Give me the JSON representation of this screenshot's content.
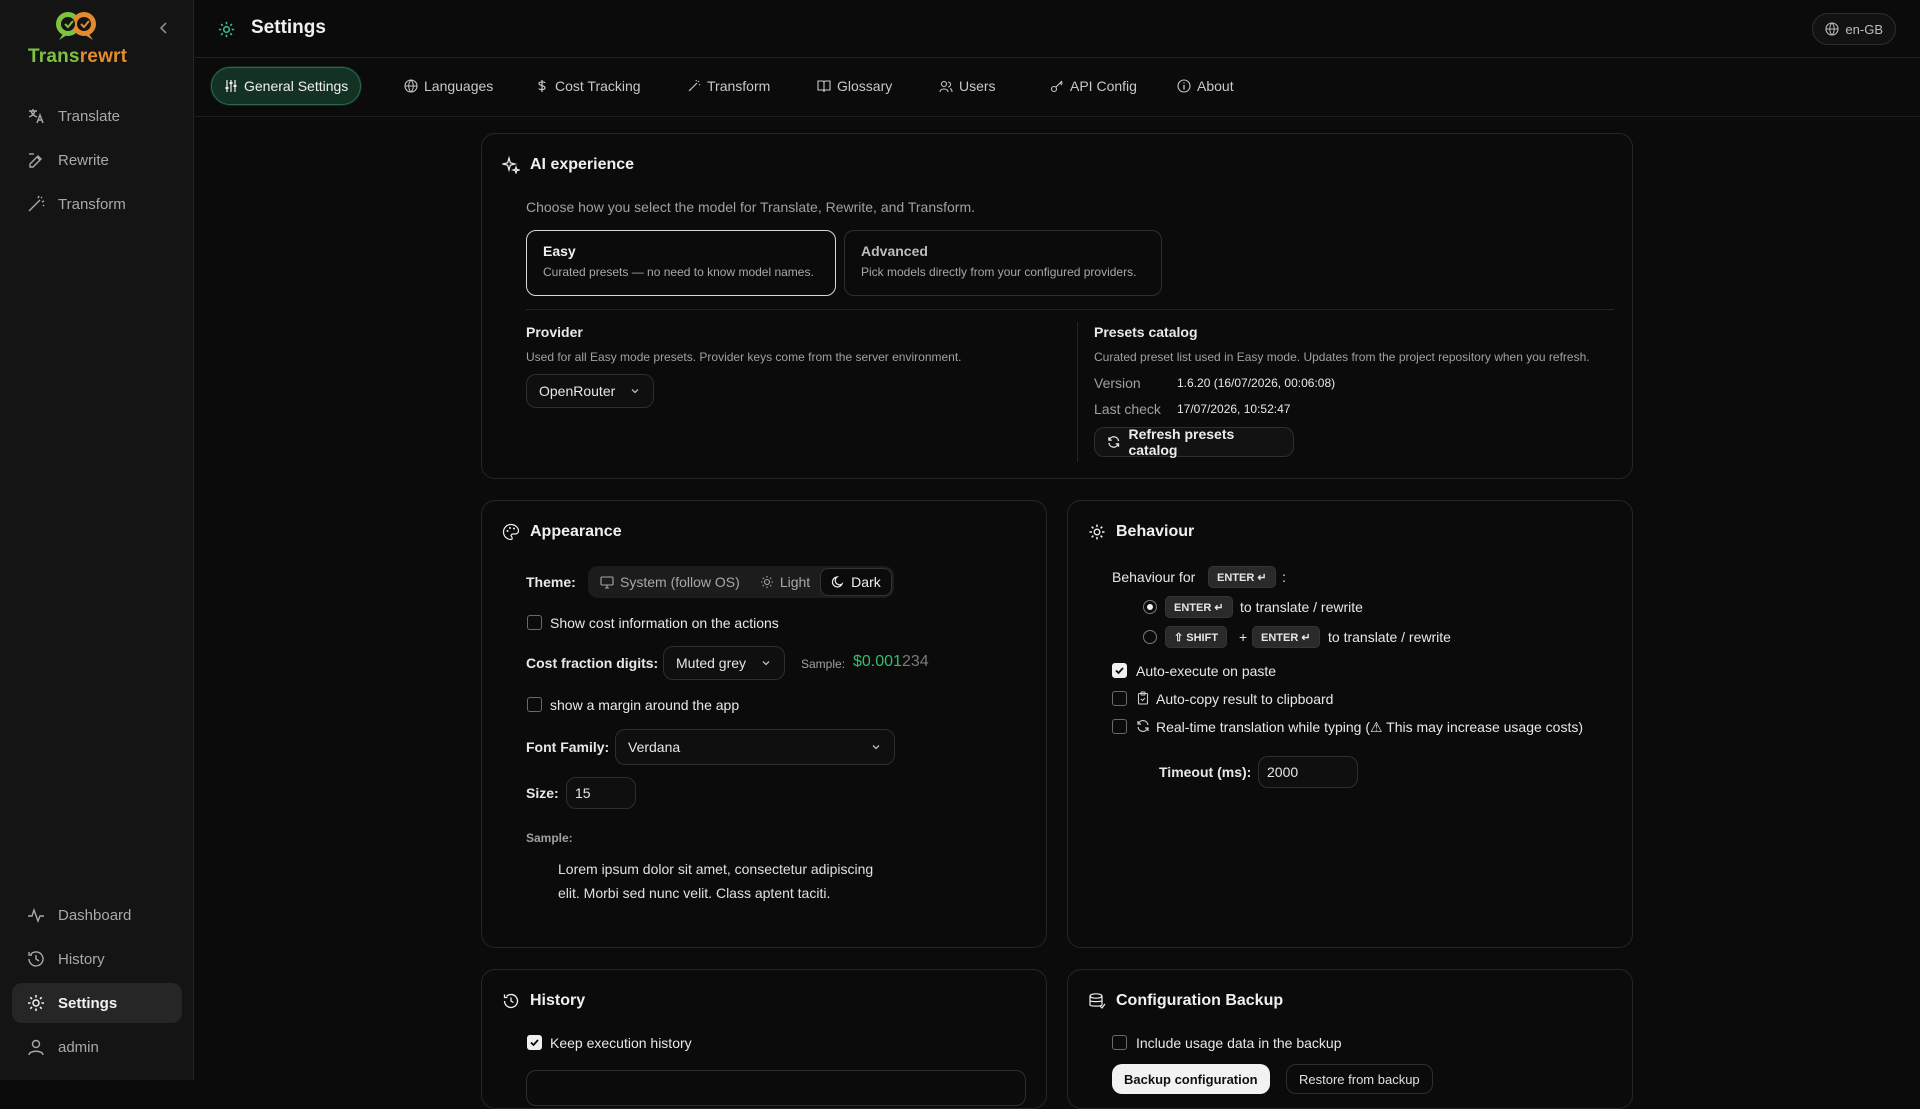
{
  "app": {
    "name_part1": "Trans",
    "name_part2": "rewrt"
  },
  "sidebar": {
    "top": [
      {
        "label": "Translate",
        "icon": "translate-icon"
      },
      {
        "label": "Rewrite",
        "icon": "rewrite-icon"
      },
      {
        "label": "Transform",
        "icon": "wand-icon"
      }
    ],
    "bottom": [
      {
        "label": "Dashboard",
        "icon": "activity-icon"
      },
      {
        "label": "History",
        "icon": "history-icon"
      },
      {
        "label": "Settings",
        "icon": "gear-icon",
        "active": true
      },
      {
        "label": "admin",
        "icon": "user-icon"
      }
    ]
  },
  "header": {
    "title": "Settings",
    "locale": "en-GB"
  },
  "tabs": [
    {
      "label": "General Settings",
      "active": true
    },
    {
      "label": "Languages"
    },
    {
      "label": "Cost Tracking"
    },
    {
      "label": "Transform"
    },
    {
      "label": "Glossary"
    },
    {
      "label": "Users"
    },
    {
      "label": "API Config"
    },
    {
      "label": "About"
    }
  ],
  "ai": {
    "title": "AI experience",
    "desc": "Choose how you select the model for Translate, Rewrite, and Transform.",
    "easy": {
      "title": "Easy",
      "desc": "Curated presets — no need to know model names."
    },
    "advanced": {
      "title": "Advanced",
      "desc": "Pick models directly from your configured providers."
    },
    "provider": {
      "label": "Provider",
      "desc": "Used for all Easy mode presets. Provider keys come from the server environment.",
      "value": "OpenRouter"
    },
    "catalog": {
      "label": "Presets catalog",
      "desc": "Curated preset list used in Easy mode. Updates from the project repository when you refresh.",
      "version_label": "Version",
      "version": "1.6.20 (16/07/2026, 00:06:08)",
      "last_check_label": "Last check",
      "last_check": "17/07/2026, 10:52:47",
      "refresh": "Refresh presets catalog"
    }
  },
  "appearance": {
    "title": "Appearance",
    "theme_label": "Theme:",
    "themes": [
      "System (follow OS)",
      "Light",
      "Dark"
    ],
    "show_cost": "Show cost information on the actions",
    "cost_digits_label": "Cost fraction digits:",
    "cost_digits_value": "Muted grey",
    "sample_label": "Sample:",
    "sample_bright": "$0.001",
    "sample_muted": "234",
    "margin": "show a margin around the app",
    "font_label": "Font Family:",
    "font_value": "Verdana",
    "size_label": "Size:",
    "size_value": "15",
    "sample_text_label": "Sample:",
    "sample_text": "Lorem ipsum dolor sit amet, consectetur adipiscing elit. Morbi sed nunc velit. Class aptent taciti."
  },
  "behaviour": {
    "title": "Behaviour",
    "for_label": "Behaviour for",
    "enter_key": "ENTER ↵",
    "colon": ":",
    "opt1": "to translate / rewrite",
    "shift_key": "⇧ SHIFT",
    "plus": "+",
    "opt2": "to translate / rewrite",
    "auto_execute": "Auto-execute on paste",
    "auto_copy": "Auto-copy result to clipboard",
    "realtime": "Real-time translation while typing (⚠ This may increase usage costs)",
    "timeout_label": "Timeout (ms):",
    "timeout_value": "2000"
  },
  "history": {
    "title": "History",
    "keep": "Keep execution history"
  },
  "backup": {
    "title": "Configuration Backup",
    "include_usage": "Include usage data in the backup",
    "backup_btn": "Backup configuration",
    "restore_btn": "Restore from backup"
  },
  "colors": {
    "accent": "#3fbf8a",
    "brand_green": "#7ec244",
    "brand_orange": "#e28b2f",
    "sample_green": "#2fbf6a"
  }
}
